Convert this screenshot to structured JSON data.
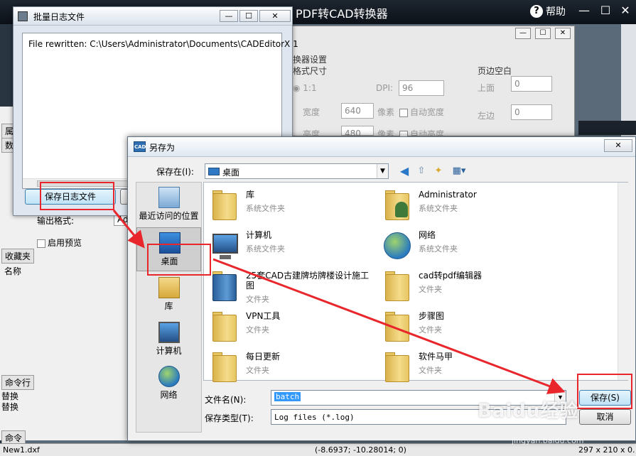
{
  "app": {
    "title": "PDF转CAD转换器",
    "help_label": "帮助",
    "status_file": "New1.dxf",
    "status_coords": "(-8.6937; -10.28014; 0)",
    "status_size": "297 x 210 x 0."
  },
  "bg_panel": {
    "tab_1": "属",
    "tab_2": "数",
    "output_format_label": "输出格式:",
    "output_format_value": "Ad",
    "enable_preview": "启用预览",
    "favorites_tab": "收藏夹",
    "name_header": "名称",
    "command_tab": "命令行",
    "replace_1": "替换",
    "replace_2": "替换",
    "command_tab_2": "命令"
  },
  "settings": {
    "section_converter": "换器设置",
    "section_format_size": "格式尺寸",
    "ratio_label": "1:1",
    "dpi_label": "DPI:",
    "dpi_value": "96",
    "width_label": "宽度",
    "width_value": "640",
    "height_label": "高度",
    "height_value": "480",
    "pixel_unit_1": "像素",
    "pixel_unit_2": "像素",
    "auto_width": "自动宽度",
    "auto_height": "自动高度",
    "margin_section": "页边空白",
    "top_label": "上面",
    "top_value": "0",
    "left_label": "左边",
    "left_value": "0"
  },
  "log_window": {
    "title": "批量日志文件",
    "log_text": "File rewritten: C:\\Users\\Administrator\\Documents\\CADEditorX 1",
    "save_log_button": "保存日志文件"
  },
  "save_dialog": {
    "title": "另存为",
    "title_icon_text": "CAD",
    "save_in_label": "保存在(I):",
    "save_in_value": "桌面",
    "places": [
      {
        "label": "最近访问的位置"
      },
      {
        "label": "桌面"
      },
      {
        "label": "库"
      },
      {
        "label": "计算机"
      },
      {
        "label": "网络"
      }
    ],
    "files": [
      {
        "name": "库",
        "type": "系统文件夹"
      },
      {
        "name": "Administrator",
        "type": "系统文件夹"
      },
      {
        "name": "计算机",
        "type": "系统文件夹"
      },
      {
        "name": "网络",
        "type": "系统文件夹"
      },
      {
        "name": "25套CAD古建牌坊牌楼设计施工图",
        "type": "文件夹"
      },
      {
        "name": "cad转pdf编辑器",
        "type": "文件夹"
      },
      {
        "name": "VPN工具",
        "type": "文件夹"
      },
      {
        "name": "步骤图",
        "type": "文件夹"
      },
      {
        "name": "每日更新",
        "type": "文件夹"
      },
      {
        "name": "软件马甲",
        "type": "文件夹"
      }
    ],
    "filename_label": "文件名(N):",
    "filename_value": "batch",
    "filetype_label": "保存类型(T):",
    "filetype_value": "Log files (*.log)",
    "save_button": "保存(S)",
    "cancel_button": "取消"
  },
  "watermark": {
    "main": "Baidu经验",
    "sub": "jingyan.baidu.com"
  },
  "colors": {
    "annotation_red": "#e8262b",
    "selection_blue": "#3399ff"
  }
}
